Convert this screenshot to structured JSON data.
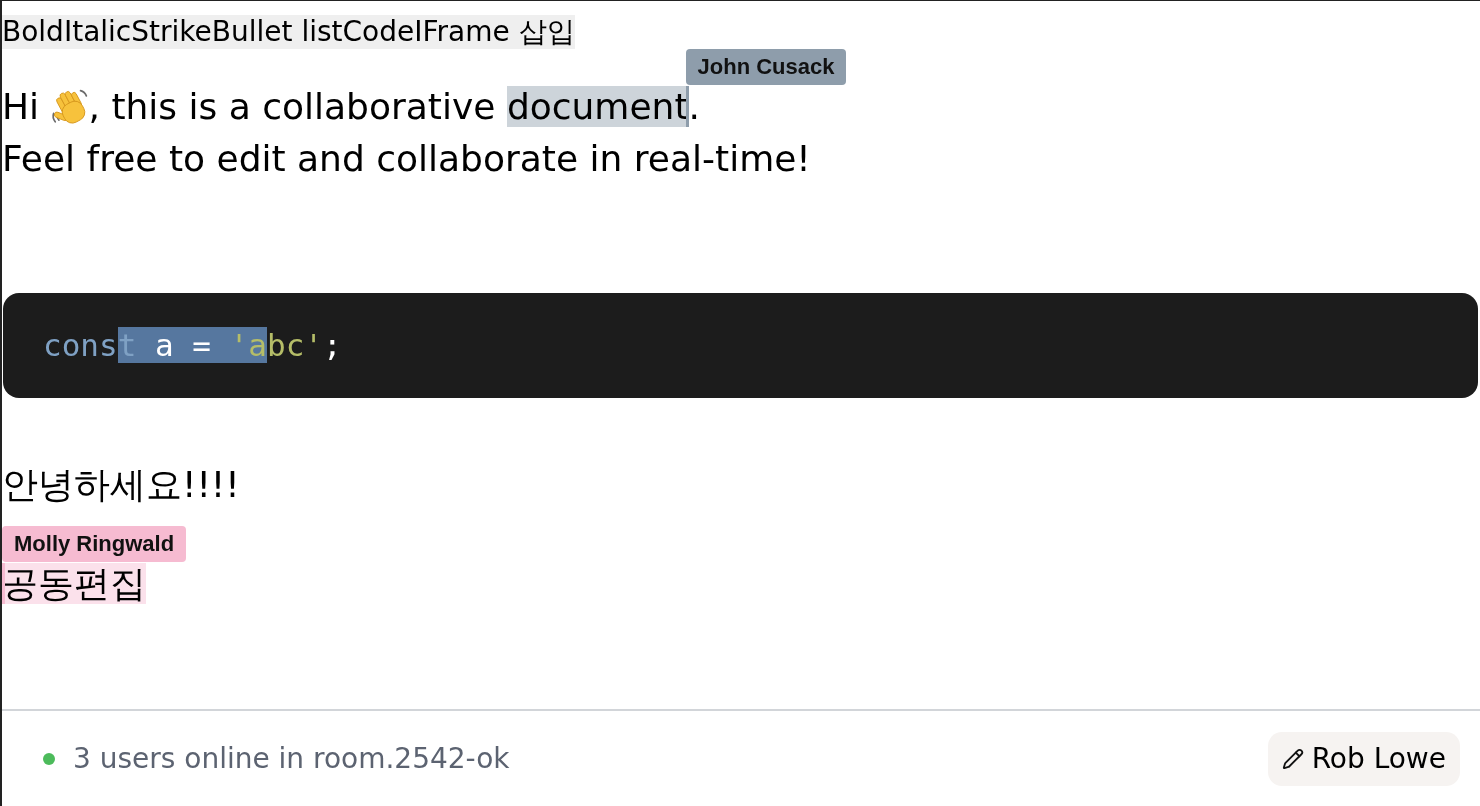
{
  "toolbar": {
    "buttons": [
      "Bold",
      "Italic",
      "Strike",
      "Bullet list",
      "Code",
      "IFrame 삽입"
    ]
  },
  "document": {
    "blocks": [
      {
        "kind": "paragraph",
        "lines": [
          {
            "segments": [
              {
                "kind": "text",
                "text": "Hi "
              },
              {
                "kind": "emoji"
              },
              {
                "kind": "text",
                "text": ", this is a collaborative "
              },
              {
                "kind": "selection",
                "text": "document",
                "cursor": {
                  "name": "John Cusack",
                  "color": "#8e9dab",
                  "caret_at_start": false
                }
              },
              {
                "kind": "text",
                "text": "."
              }
            ]
          },
          {
            "segments": [
              {
                "kind": "text",
                "text": "Feel free to edit and collaborate in real-time!"
              }
            ]
          }
        ]
      },
      {
        "kind": "code",
        "tokens": [
          {
            "text": "cons",
            "kind": "keyword",
            "selected": false
          },
          {
            "text": "t",
            "kind": "keyword",
            "selected": true
          },
          {
            "text": " a = ",
            "kind": "plain",
            "selected": true
          },
          {
            "text": "'a",
            "kind": "string",
            "selected": true
          },
          {
            "text": "bc'",
            "kind": "string",
            "selected": false
          },
          {
            "text": ";",
            "kind": "plain",
            "selected": false
          }
        ]
      },
      {
        "kind": "paragraph",
        "lines": [
          {
            "segments": [
              {
                "kind": "text",
                "text": "안녕하세요!!!!"
              }
            ]
          }
        ]
      },
      {
        "kind": "paragraph",
        "lines": [
          {
            "segments": [
              {
                "kind": "selection",
                "text": "공동편집",
                "cursor": {
                  "name": "Molly Ringwald",
                  "color": "#f6bbd1",
                  "caret_at_start": true
                }
              }
            ]
          }
        ]
      }
    ]
  },
  "footer": {
    "connected": true,
    "status": "3 users online in room.2542-ok",
    "user_button": {
      "label": "Rob Lowe"
    }
  }
}
